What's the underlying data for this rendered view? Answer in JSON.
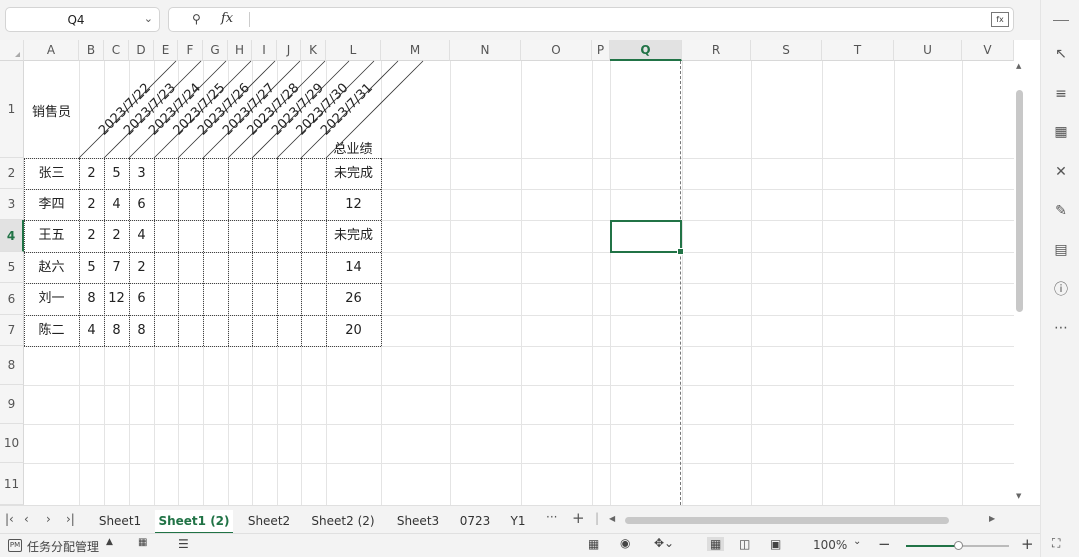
{
  "formula_bar": {
    "name_box": "Q4",
    "fx_label": "fx",
    "formula_value": ""
  },
  "columns": [
    "A",
    "B",
    "C",
    "D",
    "E",
    "F",
    "G",
    "H",
    "I",
    "J",
    "K",
    "L",
    "M",
    "N",
    "O",
    "P",
    "Q",
    "R",
    "S",
    "T",
    "U",
    "V"
  ],
  "selected_column": "Q",
  "rows": [
    "1",
    "2",
    "3",
    "4",
    "5",
    "6",
    "7",
    "8",
    "9",
    "10",
    "11"
  ],
  "selected_row": "4",
  "sheet": {
    "a1": "销售员",
    "date_headers": [
      "2023/7/22",
      "2023/7/23",
      "2023/7/24",
      "2023/7/25",
      "2023/7/26",
      "2023/7/27",
      "2023/7/28",
      "2023/7/29",
      "2023/7/30",
      "2023/7/31"
    ],
    "total_header": "总业绩",
    "data_rows": [
      {
        "name": "张三",
        "b": "2",
        "c": "5",
        "d": "3",
        "total": "未完成"
      },
      {
        "name": "李四",
        "b": "2",
        "c": "4",
        "d": "6",
        "total": "12"
      },
      {
        "name": "王五",
        "b": "2",
        "c": "2",
        "d": "4",
        "total": "未完成"
      },
      {
        "name": "赵六",
        "b": "5",
        "c": "7",
        "d": "2",
        "total": "14"
      },
      {
        "name": "刘一",
        "b": "8",
        "c": "12",
        "d": "6",
        "total": "26"
      },
      {
        "name": "陈二",
        "b": "4",
        "c": "8",
        "d": "8",
        "total": "20"
      }
    ]
  },
  "tabs": [
    "Sheet1",
    "Sheet1 (2)",
    "Sheet2",
    "Sheet2 (2)",
    "Sheet3",
    "0723",
    "Y1"
  ],
  "active_tab": "Sheet1 (2)",
  "tab_more": "···",
  "tab_add": "+",
  "status": {
    "task_manager": "任务分配管理",
    "zoom": "100%"
  },
  "right_panel_icons": [
    "cursor-icon",
    "sliders-icon",
    "crop-icon",
    "tools-icon",
    "paint-icon",
    "book-icon",
    "help-icon",
    "more-icon"
  ],
  "accent_color": "#217346"
}
